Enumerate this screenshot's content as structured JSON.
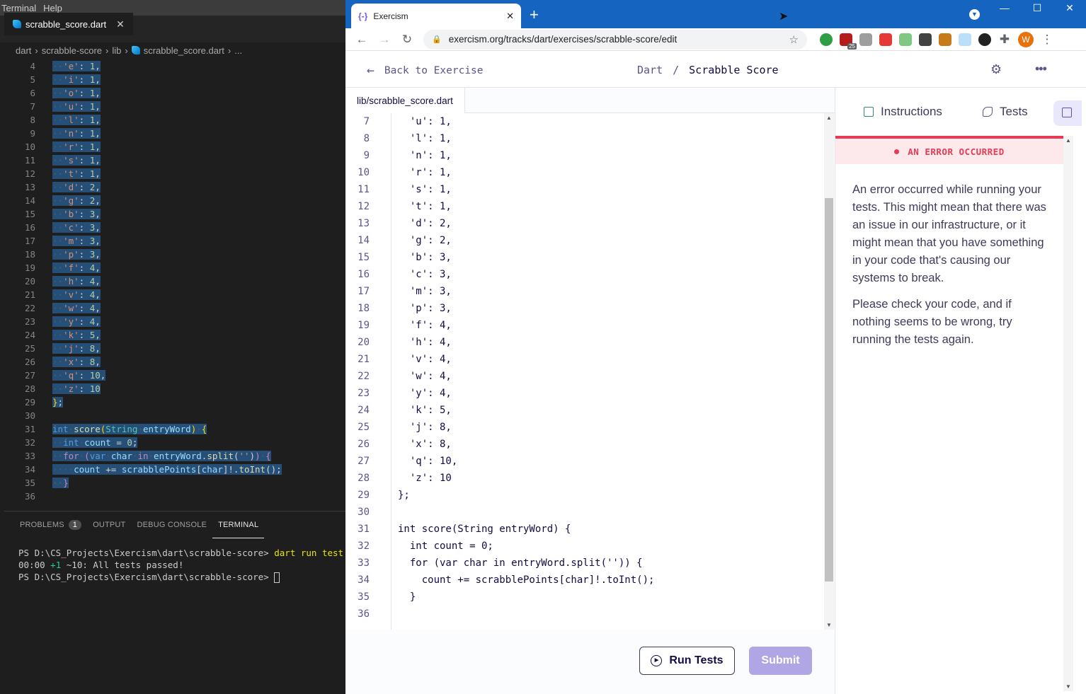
{
  "vscode": {
    "menu": [
      "Terminal",
      "Help"
    ],
    "tab": {
      "label": "scrabble_score.dart",
      "close": "✕"
    },
    "breadcrumb": [
      "dart",
      "scrabble-score",
      "lib",
      "scrabble_score.dart",
      "..."
    ],
    "panel_tabs": {
      "problems": "PROBLEMS",
      "problems_count": "1",
      "output": "OUTPUT",
      "debug": "DEBUG CONSOLE",
      "terminal": "TERMINAL"
    },
    "terminal": {
      "prompt": "PS D:\\CS_Projects\\Exercism\\dart\\scrabble-score>",
      "command": "dart run test",
      "result_time": "00:00",
      "result_pass": "+1",
      "result_count": "~10:",
      "result_msg": "All tests passed!"
    }
  },
  "browser": {
    "tab_title": "Exercism",
    "favicon": "{-}",
    "new_tab": "+",
    "window_controls": [
      "—",
      "☐",
      "✕"
    ],
    "url": "exercism.org/tracks/dart/exercises/scrabble-score/edit",
    "ext_badge": "25",
    "profile_initial": "W"
  },
  "exercism": {
    "back_label": "Back to Exercise",
    "crumb_track": "Dart",
    "crumb_sep": "/",
    "crumb_exercise": "Scrabble Score",
    "file_tab": "lib/scrabble_score.dart",
    "run_tests": "Run Tests",
    "submit": "Submit",
    "tabs": {
      "instructions": "Instructions",
      "tests": "Tests"
    },
    "error_title": "AN ERROR OCCURRED",
    "error_p1": "An error occurred while running your tests. This might mean that there was an issue in our infrastructure, or it might mean that you have something in your code that's causing our systems to break.",
    "error_p2": "Please check your code, and if nothing seems to be wrong, try running the tests again."
  },
  "code_vs": [
    {
      "n": "4",
      "k": "e",
      "v": "1"
    },
    {
      "n": "5",
      "k": "i",
      "v": "1"
    },
    {
      "n": "6",
      "k": "o",
      "v": "1"
    },
    {
      "n": "7",
      "k": "u",
      "v": "1"
    },
    {
      "n": "8",
      "k": "l",
      "v": "1"
    },
    {
      "n": "9",
      "k": "n",
      "v": "1"
    },
    {
      "n": "10",
      "k": "r",
      "v": "1"
    },
    {
      "n": "11",
      "k": "s",
      "v": "1"
    },
    {
      "n": "12",
      "k": "t",
      "v": "1"
    },
    {
      "n": "13",
      "k": "d",
      "v": "2"
    },
    {
      "n": "14",
      "k": "g",
      "v": "2"
    },
    {
      "n": "15",
      "k": "b",
      "v": "3"
    },
    {
      "n": "16",
      "k": "c",
      "v": "3"
    },
    {
      "n": "17",
      "k": "m",
      "v": "3"
    },
    {
      "n": "18",
      "k": "p",
      "v": "3"
    },
    {
      "n": "19",
      "k": "f",
      "v": "4"
    },
    {
      "n": "20",
      "k": "h",
      "v": "4"
    },
    {
      "n": "21",
      "k": "v",
      "v": "4"
    },
    {
      "n": "22",
      "k": "w",
      "v": "4"
    },
    {
      "n": "23",
      "k": "y",
      "v": "4"
    },
    {
      "n": "24",
      "k": "k",
      "v": "5"
    },
    {
      "n": "25",
      "k": "j",
      "v": "8"
    },
    {
      "n": "26",
      "k": "x",
      "v": "8"
    },
    {
      "n": "27",
      "k": "q",
      "v": "10"
    },
    {
      "n": "28",
      "k": "z",
      "v": "10",
      "last": true
    }
  ],
  "code_ex": [
    {
      "n": "7",
      "k": "u",
      "v": "1"
    },
    {
      "n": "8",
      "k": "l",
      "v": "1"
    },
    {
      "n": "9",
      "k": "n",
      "v": "1"
    },
    {
      "n": "10",
      "k": "r",
      "v": "1"
    },
    {
      "n": "11",
      "k": "s",
      "v": "1"
    },
    {
      "n": "12",
      "k": "t",
      "v": "1"
    },
    {
      "n": "13",
      "k": "d",
      "v": "2"
    },
    {
      "n": "14",
      "k": "g",
      "v": "2"
    },
    {
      "n": "15",
      "k": "b",
      "v": "3"
    },
    {
      "n": "16",
      "k": "c",
      "v": "3"
    },
    {
      "n": "17",
      "k": "m",
      "v": "3"
    },
    {
      "n": "18",
      "k": "p",
      "v": "3"
    },
    {
      "n": "19",
      "k": "f",
      "v": "4"
    },
    {
      "n": "20",
      "k": "h",
      "v": "4"
    },
    {
      "n": "21",
      "k": "v",
      "v": "4"
    },
    {
      "n": "22",
      "k": "w",
      "v": "4"
    },
    {
      "n": "23",
      "k": "y",
      "v": "4"
    },
    {
      "n": "24",
      "k": "k",
      "v": "5"
    },
    {
      "n": "25",
      "k": "j",
      "v": "8"
    },
    {
      "n": "26",
      "k": "x",
      "v": "8"
    },
    {
      "n": "27",
      "k": "q",
      "v": "10"
    },
    {
      "n": "28",
      "k": "z",
      "v": "10",
      "last": true
    }
  ],
  "code_tail": [
    {
      "n": "29",
      "t": "};"
    },
    {
      "n": "30",
      "t": ""
    },
    {
      "n": "31",
      "t": "int score(String entryWord) {"
    },
    {
      "n": "32",
      "t": "  int count = 0;"
    },
    {
      "n": "33",
      "t": "  for (var char in entryWord.split('')) {"
    },
    {
      "n": "34",
      "t": "    count += scrabblePoints[char]!.toInt();"
    },
    {
      "n": "35",
      "t": "  }"
    },
    {
      "n": "36",
      "t": ""
    }
  ],
  "colors": {
    "exercism_purple": "#604fcd",
    "error_red": "#e63b54",
    "chrome_blue": "#1565c0"
  }
}
